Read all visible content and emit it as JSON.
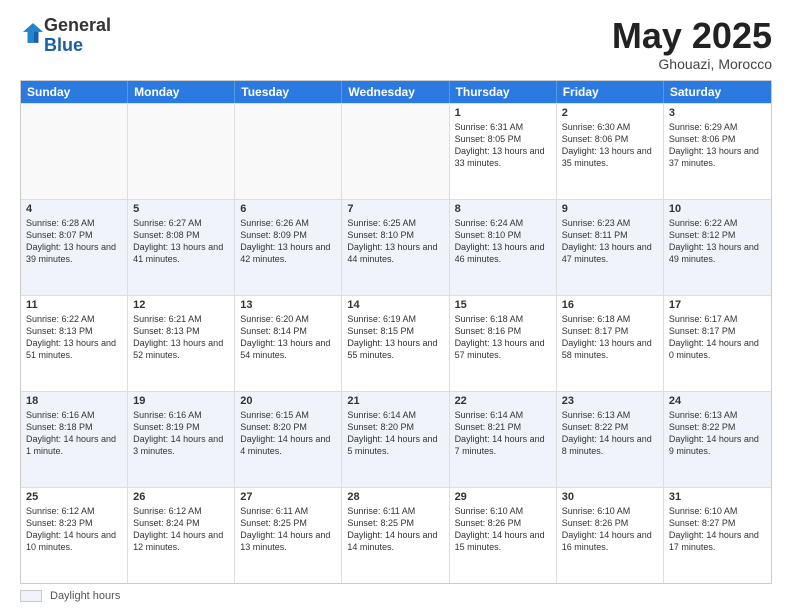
{
  "header": {
    "logo_general": "General",
    "logo_blue": "Blue",
    "month_title": "May 2025",
    "location": "Ghouazi, Morocco"
  },
  "days_of_week": [
    "Sunday",
    "Monday",
    "Tuesday",
    "Wednesday",
    "Thursday",
    "Friday",
    "Saturday"
  ],
  "weeks": [
    [
      {
        "day": "",
        "text": "",
        "empty": true
      },
      {
        "day": "",
        "text": "",
        "empty": true
      },
      {
        "day": "",
        "text": "",
        "empty": true
      },
      {
        "day": "",
        "text": "",
        "empty": true
      },
      {
        "day": "1",
        "text": "Sunrise: 6:31 AM\nSunset: 8:05 PM\nDaylight: 13 hours and 33 minutes.",
        "empty": false
      },
      {
        "day": "2",
        "text": "Sunrise: 6:30 AM\nSunset: 8:06 PM\nDaylight: 13 hours and 35 minutes.",
        "empty": false
      },
      {
        "day": "3",
        "text": "Sunrise: 6:29 AM\nSunset: 8:06 PM\nDaylight: 13 hours and 37 minutes.",
        "empty": false
      }
    ],
    [
      {
        "day": "4",
        "text": "Sunrise: 6:28 AM\nSunset: 8:07 PM\nDaylight: 13 hours and 39 minutes.",
        "empty": false
      },
      {
        "day": "5",
        "text": "Sunrise: 6:27 AM\nSunset: 8:08 PM\nDaylight: 13 hours and 41 minutes.",
        "empty": false
      },
      {
        "day": "6",
        "text": "Sunrise: 6:26 AM\nSunset: 8:09 PM\nDaylight: 13 hours and 42 minutes.",
        "empty": false
      },
      {
        "day": "7",
        "text": "Sunrise: 6:25 AM\nSunset: 8:10 PM\nDaylight: 13 hours and 44 minutes.",
        "empty": false
      },
      {
        "day": "8",
        "text": "Sunrise: 6:24 AM\nSunset: 8:10 PM\nDaylight: 13 hours and 46 minutes.",
        "empty": false
      },
      {
        "day": "9",
        "text": "Sunrise: 6:23 AM\nSunset: 8:11 PM\nDaylight: 13 hours and 47 minutes.",
        "empty": false
      },
      {
        "day": "10",
        "text": "Sunrise: 6:22 AM\nSunset: 8:12 PM\nDaylight: 13 hours and 49 minutes.",
        "empty": false
      }
    ],
    [
      {
        "day": "11",
        "text": "Sunrise: 6:22 AM\nSunset: 8:13 PM\nDaylight: 13 hours and 51 minutes.",
        "empty": false
      },
      {
        "day": "12",
        "text": "Sunrise: 6:21 AM\nSunset: 8:13 PM\nDaylight: 13 hours and 52 minutes.",
        "empty": false
      },
      {
        "day": "13",
        "text": "Sunrise: 6:20 AM\nSunset: 8:14 PM\nDaylight: 13 hours and 54 minutes.",
        "empty": false
      },
      {
        "day": "14",
        "text": "Sunrise: 6:19 AM\nSunset: 8:15 PM\nDaylight: 13 hours and 55 minutes.",
        "empty": false
      },
      {
        "day": "15",
        "text": "Sunrise: 6:18 AM\nSunset: 8:16 PM\nDaylight: 13 hours and 57 minutes.",
        "empty": false
      },
      {
        "day": "16",
        "text": "Sunrise: 6:18 AM\nSunset: 8:17 PM\nDaylight: 13 hours and 58 minutes.",
        "empty": false
      },
      {
        "day": "17",
        "text": "Sunrise: 6:17 AM\nSunset: 8:17 PM\nDaylight: 14 hours and 0 minutes.",
        "empty": false
      }
    ],
    [
      {
        "day": "18",
        "text": "Sunrise: 6:16 AM\nSunset: 8:18 PM\nDaylight: 14 hours and 1 minute.",
        "empty": false
      },
      {
        "day": "19",
        "text": "Sunrise: 6:16 AM\nSunset: 8:19 PM\nDaylight: 14 hours and 3 minutes.",
        "empty": false
      },
      {
        "day": "20",
        "text": "Sunrise: 6:15 AM\nSunset: 8:20 PM\nDaylight: 14 hours and 4 minutes.",
        "empty": false
      },
      {
        "day": "21",
        "text": "Sunrise: 6:14 AM\nSunset: 8:20 PM\nDaylight: 14 hours and 5 minutes.",
        "empty": false
      },
      {
        "day": "22",
        "text": "Sunrise: 6:14 AM\nSunset: 8:21 PM\nDaylight: 14 hours and 7 minutes.",
        "empty": false
      },
      {
        "day": "23",
        "text": "Sunrise: 6:13 AM\nSunset: 8:22 PM\nDaylight: 14 hours and 8 minutes.",
        "empty": false
      },
      {
        "day": "24",
        "text": "Sunrise: 6:13 AM\nSunset: 8:22 PM\nDaylight: 14 hours and 9 minutes.",
        "empty": false
      }
    ],
    [
      {
        "day": "25",
        "text": "Sunrise: 6:12 AM\nSunset: 8:23 PM\nDaylight: 14 hours and 10 minutes.",
        "empty": false
      },
      {
        "day": "26",
        "text": "Sunrise: 6:12 AM\nSunset: 8:24 PM\nDaylight: 14 hours and 12 minutes.",
        "empty": false
      },
      {
        "day": "27",
        "text": "Sunrise: 6:11 AM\nSunset: 8:25 PM\nDaylight: 14 hours and 13 minutes.",
        "empty": false
      },
      {
        "day": "28",
        "text": "Sunrise: 6:11 AM\nSunset: 8:25 PM\nDaylight: 14 hours and 14 minutes.",
        "empty": false
      },
      {
        "day": "29",
        "text": "Sunrise: 6:10 AM\nSunset: 8:26 PM\nDaylight: 14 hours and 15 minutes.",
        "empty": false
      },
      {
        "day": "30",
        "text": "Sunrise: 6:10 AM\nSunset: 8:26 PM\nDaylight: 14 hours and 16 minutes.",
        "empty": false
      },
      {
        "day": "31",
        "text": "Sunrise: 6:10 AM\nSunset: 8:27 PM\nDaylight: 14 hours and 17 minutes.",
        "empty": false
      }
    ]
  ],
  "footer": {
    "legend_label": "Daylight hours"
  }
}
